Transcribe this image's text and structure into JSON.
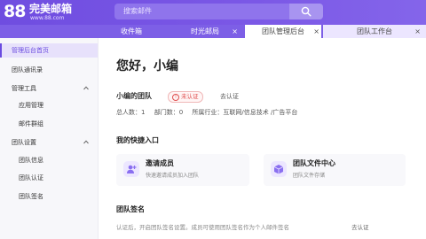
{
  "header": {
    "logo_number": "88",
    "logo_name": "完美邮箱",
    "logo_domain": "www.88.com",
    "search_placeholder": "搜索邮件",
    "accent_color": "#7b58e6"
  },
  "tabs": [
    {
      "label": "收件箱"
    },
    {
      "label": "时光邮局",
      "close": "×"
    },
    {
      "label": "团队管理后台",
      "close": "×"
    },
    {
      "label": "团队工作台",
      "close": "×"
    }
  ],
  "sidebar": {
    "items": [
      {
        "label": "管理后台首页"
      },
      {
        "label": "团队通讯录"
      },
      {
        "label": "管理工具"
      },
      {
        "label": "应用管理"
      },
      {
        "label": "邮件群组"
      },
      {
        "label": "团队设置"
      },
      {
        "label": "团队信息"
      },
      {
        "label": "团队认证"
      },
      {
        "label": "团队签名"
      }
    ]
  },
  "main": {
    "greeting": "您好，小编",
    "team_name": "小编的团队",
    "badge": "未认证",
    "badge_icon": "!",
    "verify_link": "去认证",
    "stats": {
      "members": "总人数：1",
      "departments": "部门数：0",
      "industry": "所属行业：互联网/信息技术 /广告平台"
    },
    "shortcuts_title": "我的快捷入口",
    "cards": [
      {
        "title": "邀请成员",
        "desc": "快速邀请成员加入团队",
        "icon": "add-user-icon"
      },
      {
        "title": "团队文件中心",
        "desc": "团队文件存储",
        "icon": "file-box-icon"
      }
    ],
    "signature_title": "团队签名",
    "signature_desc": "认证后，开启团队签名设置。成员可使用团队签名作为个人邮件签名",
    "signature_link": "去认证"
  }
}
